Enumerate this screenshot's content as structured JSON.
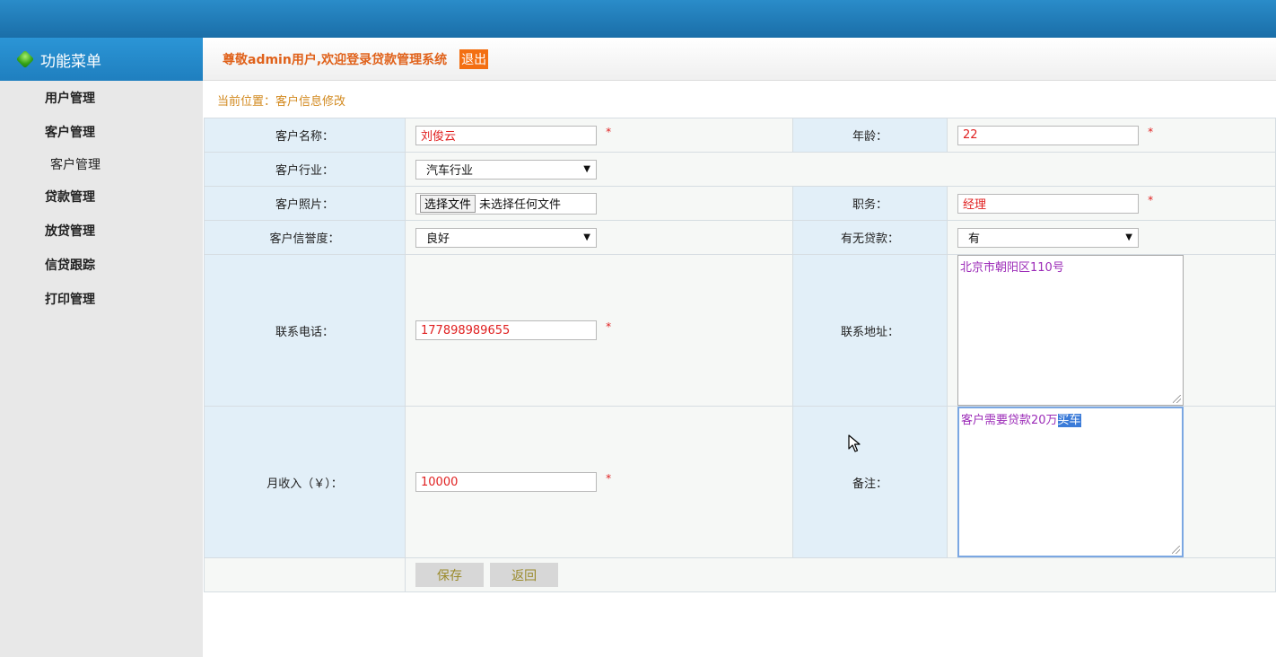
{
  "sidebar": {
    "title": "功能菜单",
    "items": [
      {
        "label": "用户管理"
      },
      {
        "label": "客户管理"
      },
      {
        "label": "客户管理"
      },
      {
        "label": "贷款管理"
      },
      {
        "label": "放贷管理"
      },
      {
        "label": "信贷跟踪"
      },
      {
        "label": "打印管理"
      }
    ]
  },
  "header": {
    "welcome": "尊敬admin用户,欢迎登录贷款管理系统",
    "logout": "退出"
  },
  "breadcrumb": "当前位置：客户信息修改",
  "form": {
    "customer_name": {
      "label": "客户名称：",
      "value": "刘俊云",
      "star": "*"
    },
    "age": {
      "label": "年龄：",
      "value": "22",
      "star": "*"
    },
    "industry": {
      "label": "客户行业：",
      "value": "汽车行业"
    },
    "photo": {
      "label": "客户照片：",
      "button": "选择文件",
      "status": "未选择任何文件"
    },
    "position": {
      "label": "职务：",
      "value": "经理",
      "star": "*"
    },
    "credit": {
      "label": "客户信誉度：",
      "value": "良好"
    },
    "has_loan": {
      "label": "有无贷款：",
      "value": "有"
    },
    "phone": {
      "label": "联系电话：",
      "value": "177898989655",
      "star": "*"
    },
    "address": {
      "label": "联系地址：",
      "value": "北京市朝阳区110号"
    },
    "income": {
      "label": "月收入（￥）：",
      "value": "10000",
      "star": "*"
    },
    "remark": {
      "label": "备注：",
      "value_plain": "客户需要贷款20万",
      "value_selected": "买车"
    },
    "buttons": {
      "save": "保存",
      "back": "返回"
    }
  },
  "colors": {
    "topbar": "#1a6ea8",
    "accent_orange": "#f36f12",
    "label_bg": "#e2eff8",
    "required_red": "#e02020"
  }
}
